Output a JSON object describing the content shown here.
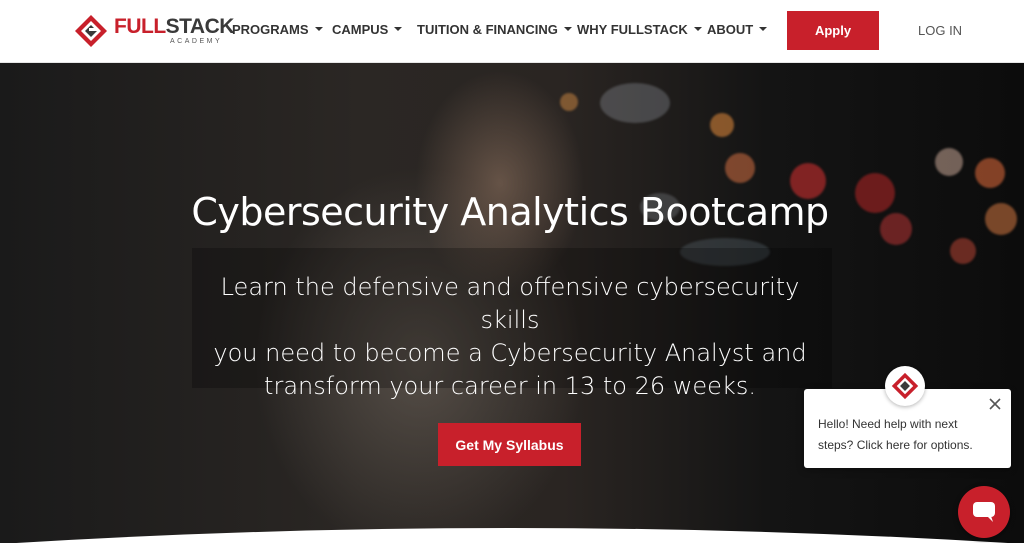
{
  "header": {
    "logo": {
      "brand_full": "FULL",
      "brand_stack": "STACK",
      "brand_sub": "ACADEMY"
    },
    "nav": [
      {
        "label": "PROGRAMS"
      },
      {
        "label": "CAMPUS"
      },
      {
        "label": "TUITION & FINANCING"
      },
      {
        "label": "WHY FULLSTACK"
      },
      {
        "label": "ABOUT"
      }
    ],
    "apply_label": "Apply",
    "login_label": "LOG IN"
  },
  "hero": {
    "title": "Cybersecurity Analytics Bootcamp",
    "subtitle_lines": [
      "Learn the defensive and offensive cybersecurity skills",
      "you need to become a Cybersecurity Analyst and",
      "transform your career in 13 to 26 weeks."
    ],
    "cta_label": "Get My Syllabus"
  },
  "chat": {
    "message_lines": [
      "Hello! Need help with next",
      "steps? Click here for options."
    ]
  },
  "colors": {
    "brand_red": "#c8202b",
    "header_bg": "#ffffff",
    "nav_text": "#333333"
  },
  "icons": {
    "logo": "fullstack-logo-icon",
    "caret": "caret-down-icon",
    "close": "close-icon",
    "chat": "chat-bubble-icon"
  }
}
